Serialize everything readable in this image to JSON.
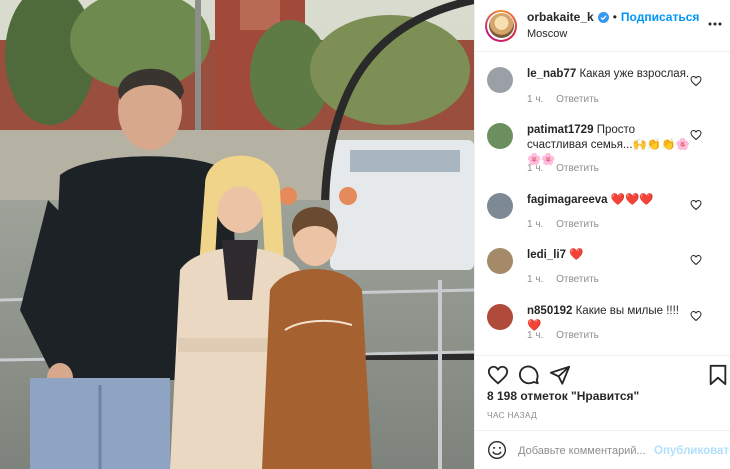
{
  "post": {
    "photo_alt": "",
    "header": {
      "username": "orbakaite_k",
      "verified_icon": "verified-badge-icon",
      "separator": "•",
      "follow_label": "Подписаться",
      "location": "Moscow",
      "more_icon": "more-horizontal-icon"
    },
    "comments": [
      {
        "user": "le_nab77",
        "text": "Какая уже взрослая.",
        "time": "1 ч.",
        "reply": "Ответить",
        "avatar_color": "#9aa0a6"
      },
      {
        "user": "patimat1729",
        "text": "Просто счастливая семья...🙌👏👏🌸🌸🌸",
        "time": "1 ч.",
        "reply": "Ответить",
        "avatar_color": "#6b8f5e"
      },
      {
        "user": "fagimagareeva",
        "text": "❤️❤️❤️",
        "time": "1 ч.",
        "reply": "Ответить",
        "avatar_color": "#7d8a95"
      },
      {
        "user": "ledi_li7",
        "text": "❤️",
        "time": "1 ч.",
        "reply": "Ответить",
        "avatar_color": "#a58a6a"
      },
      {
        "user": "n850192",
        "text": "Какие вы милые !!!! ❤️",
        "time": "1 ч.",
        "reply": "Ответить",
        "avatar_color": "#b04a3a"
      }
    ],
    "actions": {
      "like_icon": "heart-icon",
      "comment_icon": "comment-icon",
      "share_icon": "share-icon",
      "save_icon": "bookmark-icon",
      "likes_text": "8 198 отметок \"Нравится\"",
      "time_ago": "ЧАС НАЗАД"
    },
    "comment_box": {
      "emoji_icon": "emoji-icon",
      "placeholder": "Добавьте комментарий...",
      "publish_label": "Опубликовать"
    },
    "colors": {
      "link": "#0095f6",
      "publish_disabled": "#b2dffc",
      "muted": "#8e8e8e",
      "heart_red": "#ed4956"
    }
  }
}
